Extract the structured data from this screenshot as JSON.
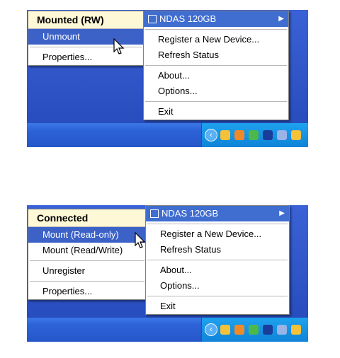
{
  "screenshot_top": {
    "submenu": {
      "header": "Mounted (RW)",
      "items": [
        {
          "label": "Unmount",
          "highlighted": true
        },
        {
          "label": "Properties...",
          "highlighted": false
        }
      ]
    },
    "main_menu": {
      "device": "NDAS 120GB",
      "items": [
        "Register a New Device...",
        "Refresh Status",
        "About...",
        "Options...",
        "Exit"
      ]
    }
  },
  "screenshot_bottom": {
    "submenu": {
      "header": "Connected",
      "items": [
        {
          "label": "Mount (Read-only)",
          "highlighted": true
        },
        {
          "label": "Mount (Read/Write)",
          "highlighted": false
        },
        {
          "label": "Unregister",
          "highlighted": false
        },
        {
          "label": "Properties...",
          "highlighted": false
        }
      ]
    },
    "main_menu": {
      "device": "NDAS 120GB",
      "items": [
        "Register a New Device...",
        "Refresh Status",
        "About...",
        "Options...",
        "Exit"
      ]
    }
  },
  "colors": {
    "highlight": "#3c62c8",
    "header_bg": "#fff8d6",
    "taskbar": "#2456c8"
  }
}
